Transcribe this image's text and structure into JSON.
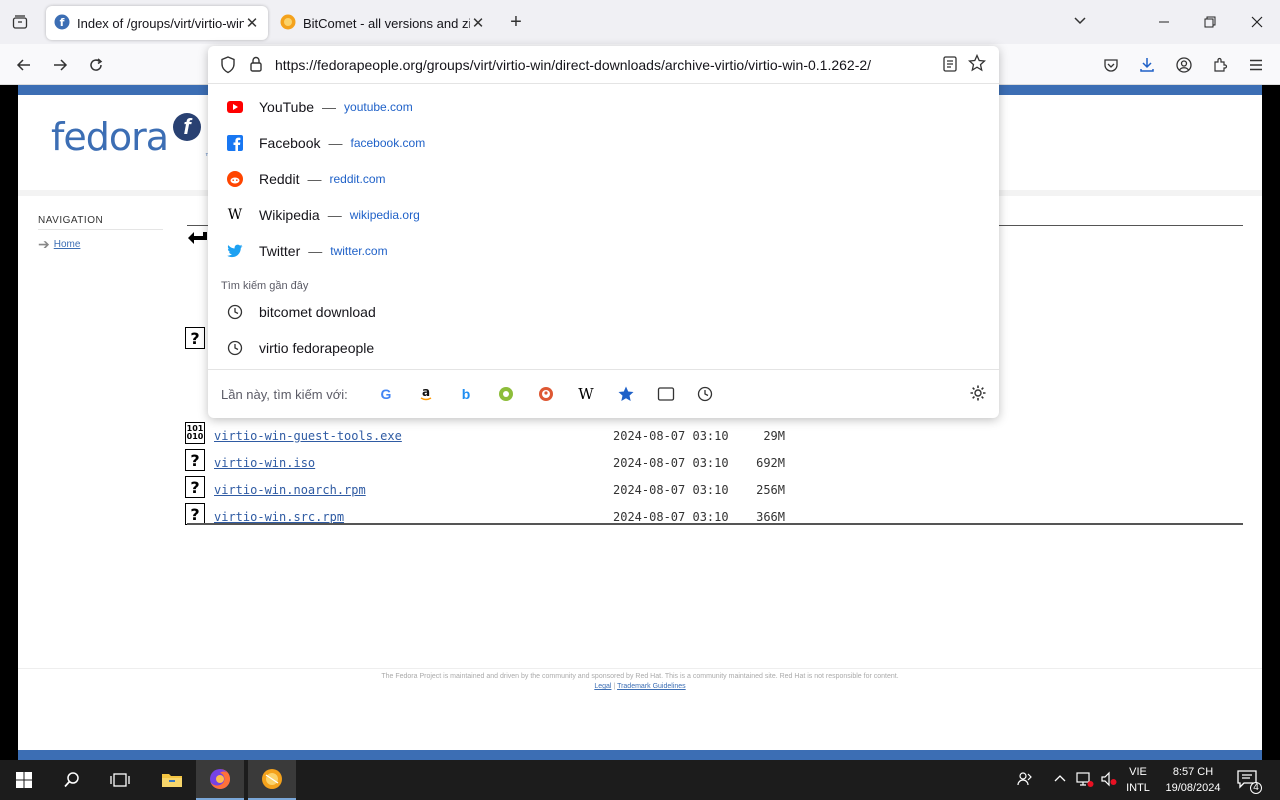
{
  "browser": {
    "tabs": [
      {
        "title": "Index of /groups/virt/virtio-win",
        "active": true
      },
      {
        "title": "BitComet - all versions and zip p",
        "active": false
      }
    ],
    "url": "https://fedorapeople.org/groups/virt/virtio-win/direct-downloads/archive-virtio/virtio-win-0.1.262-2/"
  },
  "dropdown": {
    "top_sites": [
      {
        "name": "YouTube",
        "domain": "youtube.com",
        "color": "#ff0000"
      },
      {
        "name": "Facebook",
        "domain": "facebook.com",
        "color": "#1877f2"
      },
      {
        "name": "Reddit",
        "domain": "reddit.com",
        "color": "#ff4500"
      },
      {
        "name": "Wikipedia",
        "domain": "wikipedia.org",
        "color": "#000000"
      },
      {
        "name": "Twitter",
        "domain": "twitter.com",
        "color": "#1da1f2"
      }
    ],
    "separator": "—",
    "recent_heading": "Tìm kiếm gần đây",
    "recent_searches": [
      "bitcomet download",
      "virtio fedorapeople"
    ],
    "oneoff_label": "Lần này, tìm kiếm với:"
  },
  "page": {
    "logo_text": "fedora",
    "logo_mark": "f",
    "logo_tm": "™",
    "nav_heading": "NAVIGATION",
    "nav_home": "Home",
    "files": [
      {
        "name": "virtio-win-guest-tools.exe",
        "date": "2024-08-07 03:10",
        "size": "29M",
        "icon": "binary"
      },
      {
        "name": "virtio-win.iso",
        "date": "2024-08-07 03:10",
        "size": "692M",
        "icon": "unknown"
      },
      {
        "name": "virtio-win.noarch.rpm",
        "date": "2024-08-07 03:10",
        "size": "256M",
        "icon": "unknown"
      },
      {
        "name": "virtio-win.src.rpm",
        "date": "2024-08-07 03:10",
        "size": "366M",
        "icon": "unknown"
      }
    ],
    "footer_text": "The Fedora Project is maintained and driven by the community and sponsored by Red Hat. This is a community maintained site. Red Hat is not responsible for content.",
    "footer_legal": "Legal",
    "footer_pipe": "|",
    "footer_trademark": "Trademark Guidelines"
  },
  "taskbar": {
    "lang_line1": "VIE",
    "lang_line2": "INTL",
    "time": "8:57 CH",
    "date": "19/08/2024",
    "notification_count": "4"
  }
}
